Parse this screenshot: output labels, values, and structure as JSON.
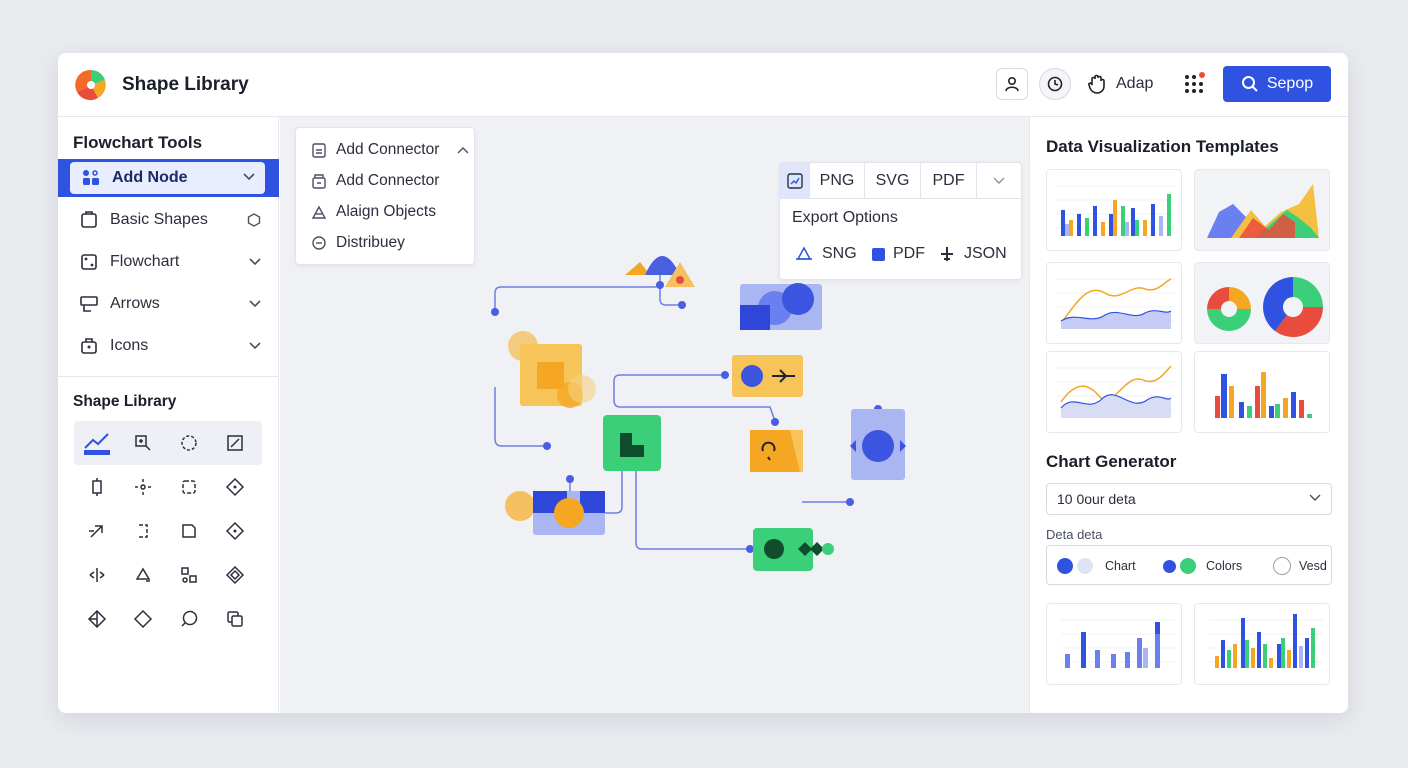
{
  "app": {
    "title": "Shape Library"
  },
  "header": {
    "adapt_label": "Adap",
    "primary_label": "Sepop"
  },
  "sidebar": {
    "section_title": "Flowchart Tools",
    "items": [
      {
        "label": "Add Node",
        "icon": "nodes-icon"
      },
      {
        "label": "Basic Shapes",
        "icon": "shapes-icon"
      },
      {
        "label": "Flowchart",
        "icon": "flowchart-icon"
      },
      {
        "label": "Arrows",
        "icon": "arrows-icon"
      },
      {
        "label": "Icons",
        "icon": "icons-icon"
      }
    ],
    "library_title": "Shape Library"
  },
  "connector_menu": {
    "items": [
      {
        "label": "Add Connector"
      },
      {
        "label": "Add Connector"
      },
      {
        "label": "Alaign Objects"
      },
      {
        "label": "Distribuey"
      }
    ]
  },
  "export": {
    "tabs": [
      "PNG",
      "SVG",
      "PDF"
    ],
    "title": "Export Options",
    "options": [
      "SNG",
      "PDF",
      "JSON"
    ]
  },
  "right_panel": {
    "templates_title": "Data Visualization Templates",
    "generator_title": "Chart Generator",
    "select_value": "10 0our deta",
    "data_label": "Deta deta",
    "options": [
      "Chart",
      "Colors",
      "Vesd"
    ]
  },
  "colors": {
    "primary": "#2f52e0",
    "green": "#3ccf7a",
    "orange": "#f5a623",
    "blue_light": "#a9b6f2",
    "red": "#e94b3c"
  }
}
